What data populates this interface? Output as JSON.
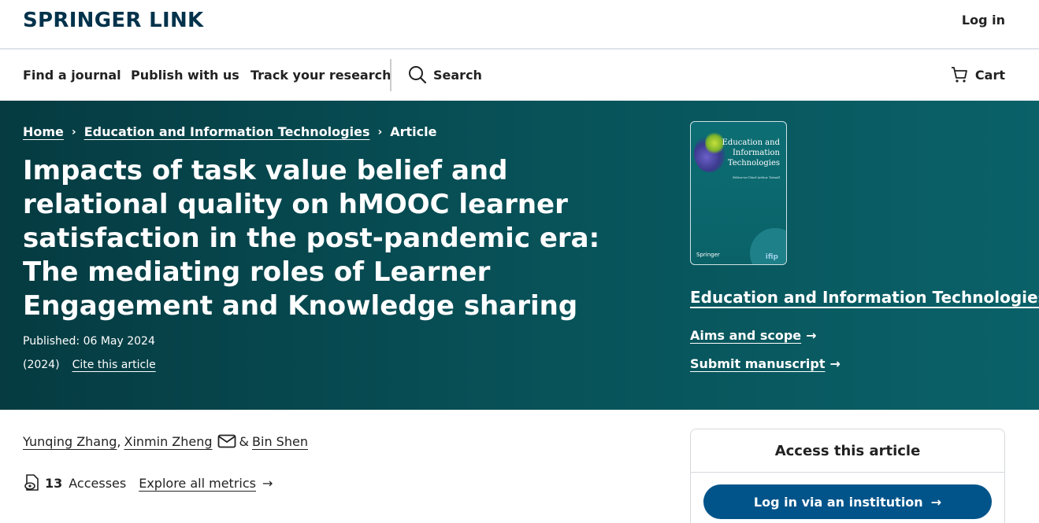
{
  "header": {
    "logo": "SPRINGER LINK",
    "login_label": "Log in"
  },
  "nav": {
    "items": [
      "Find a journal",
      "Publish with us",
      "Track your research"
    ],
    "search_label": "Search",
    "cart_label": "Cart"
  },
  "breadcrumb": [
    "Home",
    "Education and Information Technologies",
    "Article"
  ],
  "article": {
    "title": "Impacts of task value belief and relational quality on hMOOC learner satisfaction in the post-pandemic era: The mediating roles of Learner Engagement and Knowledge sharing",
    "published": "Published: 06 May 2024",
    "year": "(2024)",
    "cite_label": "Cite this article",
    "authors": [
      "Yunqing Zhang",
      "Xinmin Zheng",
      "Bin Shen"
    ],
    "author_sep_1": ",",
    "author_sep_2": "&",
    "accesses_count": "13",
    "accesses_label": "Accesses",
    "explore_label": "Explore all metrics"
  },
  "journal": {
    "cover_title": "Education and Information Technologies",
    "cover_editor": "Editor-in-Chief Arthur Tatnall",
    "cover_publisher": "Springer",
    "cover_badge": "ifip",
    "name": "Education and Information Technologies",
    "aims_label": "Aims and scope",
    "submit_label": "Submit manuscript"
  },
  "access": {
    "title": "Access this article",
    "button_label": "Log in via an institution"
  },
  "colors": {
    "logo": "#01324b",
    "hero_start": "#053b41",
    "hero_end": "#0a6168",
    "primary_button": "#01548a"
  }
}
